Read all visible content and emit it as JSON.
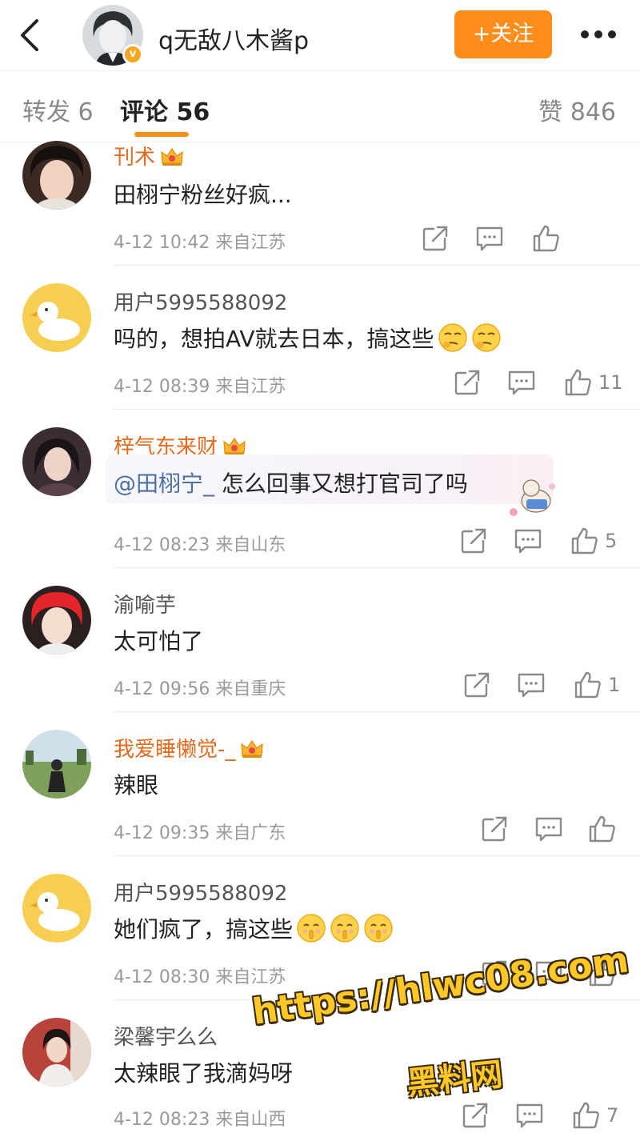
{
  "header": {
    "title": "q无敌八木酱p",
    "follow_label": "+关注"
  },
  "tabs": {
    "repost": "转发 6",
    "comments": "评论 56",
    "likes": "赞 846"
  },
  "colors": {
    "accent": "#ff8d1a",
    "vip_name": "#e96a1d",
    "mention": "#4a6fa5"
  },
  "comments": [
    {
      "user": "刊术",
      "vip": true,
      "text": "田栩宁粉丝好疯...",
      "time": "4-12 10:42",
      "location": "来自江苏",
      "likes": ""
    },
    {
      "user": "用户5995588092",
      "vip": false,
      "text": "吗的，想拍AV就去日本，搞这些",
      "time": "4-12 08:39",
      "location": "来自江苏",
      "likes": "11"
    },
    {
      "user": "梓气东来财",
      "vip": true,
      "mention": "@田栩宁_",
      "text": " 怎么回事又想打官司了吗",
      "time": "4-12 08:23",
      "location": "来自山东",
      "likes": "5"
    },
    {
      "user": "渝喻芋",
      "vip": false,
      "text": "太可怕了",
      "time": "4-12 09:56",
      "location": "来自重庆",
      "likes": "1"
    },
    {
      "user": "我爱睡懒觉-_",
      "vip": true,
      "text": "辣眼",
      "time": "4-12 09:35",
      "location": "来自广东",
      "likes": ""
    },
    {
      "user": "用户5995588092",
      "vip": false,
      "text": "她们疯了，搞这些",
      "time": "4-12 08:30",
      "location": "来自江苏",
      "likes": ""
    },
    {
      "user": "梁馨宇么么",
      "vip": false,
      "text": "太辣眼了我滴妈呀",
      "time": "4-12 08:23",
      "location": "来自山西",
      "likes": "7"
    }
  ],
  "watermark": {
    "url": "https://hlwc08.com",
    "name": "黑料网"
  }
}
